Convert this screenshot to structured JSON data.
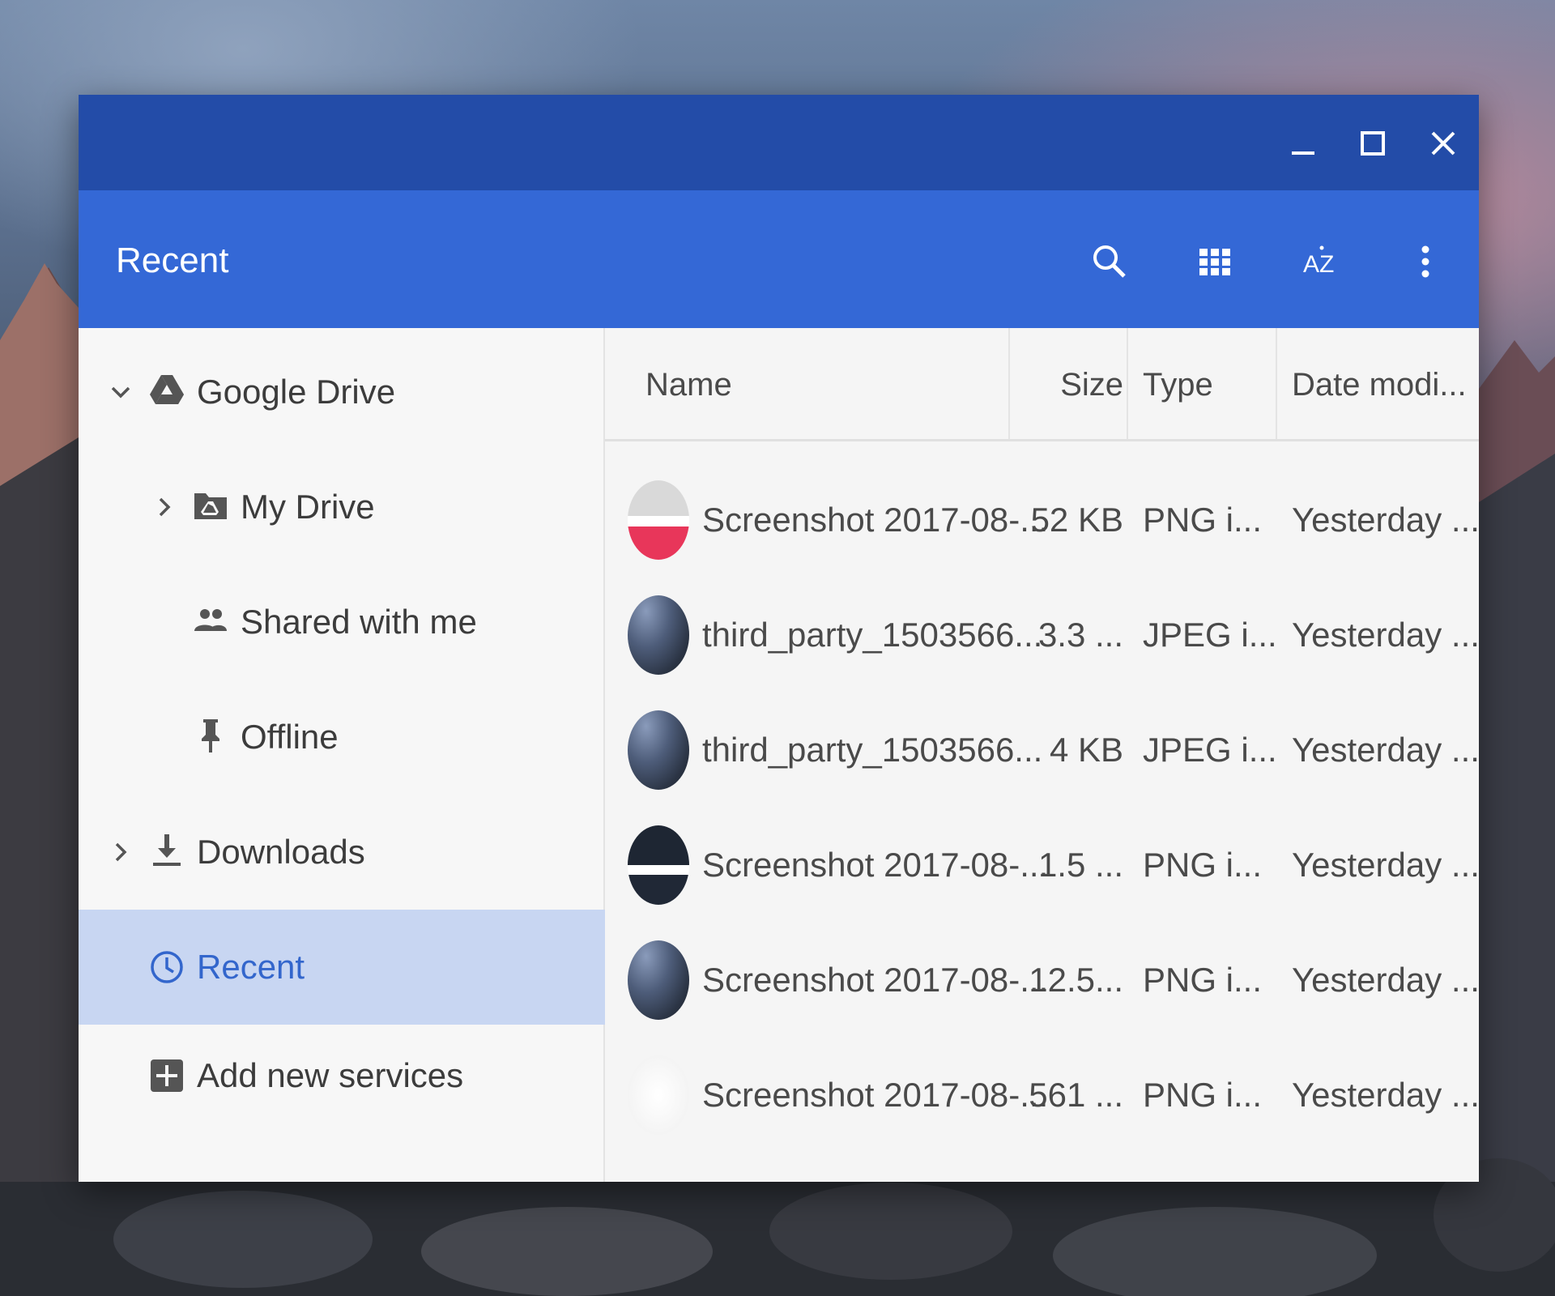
{
  "window": {
    "controls": {
      "minimize_icon": "minimize-icon",
      "maximize_icon": "maximize-icon",
      "close_icon": "close-icon"
    }
  },
  "toolbar": {
    "title": "Recent",
    "buttons": [
      "search-icon",
      "grid-view-icon",
      "sort-az-icon",
      "more-vert-icon"
    ],
    "sort_label": "AZ"
  },
  "sidebar": {
    "items": [
      {
        "label": "Google Drive",
        "icon": "google-drive-icon",
        "expander": "chevron-down-icon"
      },
      {
        "label": "My Drive",
        "icon": "drive-folder-icon",
        "expander": "chevron-right-icon"
      },
      {
        "label": "Shared with me",
        "icon": "people-icon"
      },
      {
        "label": "Offline",
        "icon": "pin-icon"
      },
      {
        "label": "Downloads",
        "icon": "download-icon",
        "expander": "chevron-right-icon"
      },
      {
        "label": "Recent",
        "icon": "clock-icon",
        "selected": true
      },
      {
        "label": "Add new services",
        "icon": "add-box-icon"
      }
    ]
  },
  "filelist": {
    "columns": [
      "Name",
      "Size",
      "Type",
      "Date modi..."
    ],
    "rows": [
      {
        "name": "Screenshot 2017-08-...",
        "size": "52 KB",
        "type": "PNG i...",
        "date": "Yesterday ..."
      },
      {
        "name": "third_party_1503566...",
        "size": "3.3 ...",
        "type": "JPEG i...",
        "date": "Yesterday ..."
      },
      {
        "name": "third_party_1503566...",
        "size": "4 KB",
        "type": "JPEG i...",
        "date": "Yesterday ..."
      },
      {
        "name": "Screenshot 2017-08-...",
        "size": "1.5 ...",
        "type": "PNG i...",
        "date": "Yesterday ..."
      },
      {
        "name": "Screenshot 2017-08-...",
        "size": "12.5...",
        "type": "PNG i...",
        "date": "Yesterday ..."
      },
      {
        "name": "Screenshot 2017-08-...",
        "size": "561 ...",
        "type": "PNG i...",
        "date": "Yesterday ..."
      }
    ]
  },
  "colors": {
    "titlebar": "#234ca8",
    "toolbar": "#3468d6",
    "selected_bg": "#c8d6f2",
    "selected_text": "#3366cc"
  }
}
